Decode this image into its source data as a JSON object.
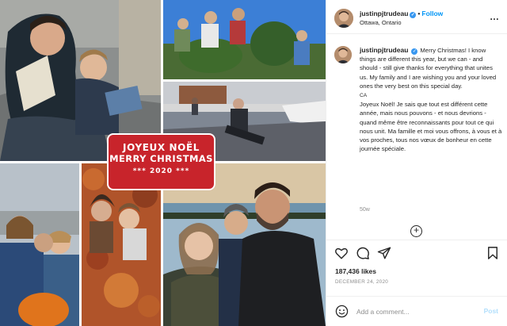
{
  "post": {
    "banner": {
      "line1": "JOYEUX NOËL",
      "line2": "MERRY CHRISTMAS",
      "line3": "*** 2020 ***"
    }
  },
  "header": {
    "username": "justinpjtrudeau",
    "verified_icon": "verified-badge-icon",
    "separator": "•",
    "follow_label": "Follow",
    "location": "Ottawa, Ontario",
    "more_icon": "more-options-icon",
    "more_label": "…"
  },
  "caption": {
    "username": "justinpjtrudeau",
    "text_en": "Merry Christmas! I know things are different this year, but we can - and should - still give thanks for everything that unites us. My family and I are wishing you and your loved ones the very best on this special day.",
    "tag": "CA",
    "text_fr": "Joyeux Noël! Je sais que tout est différent cette année, mais nous pouvons - et nous devrions - quand même être reconnaissants pour tout ce qui nous unit. Ma famille et moi vous offrons, à vous et à vos proches, tous nos vœux de bonheur en cette journée spéciale.",
    "time": "50w",
    "load_more_icon": "plus-circle-icon",
    "load_more_label": "+"
  },
  "actions": {
    "icons": [
      "heart-icon",
      "comment-icon",
      "share-icon",
      "bookmark-icon"
    ]
  },
  "likes": "187,436 likes",
  "date": "DECEMBER 24, 2020",
  "comment": {
    "emoji_icon": "emoji-icon",
    "placeholder": "Add a comment...",
    "post_label": "Post"
  },
  "colors": {
    "banner_red": "#c8242b",
    "follow_blue": "#0095f6",
    "post_disabled": "#b2dffc",
    "verified_blue": "#3897f0"
  }
}
